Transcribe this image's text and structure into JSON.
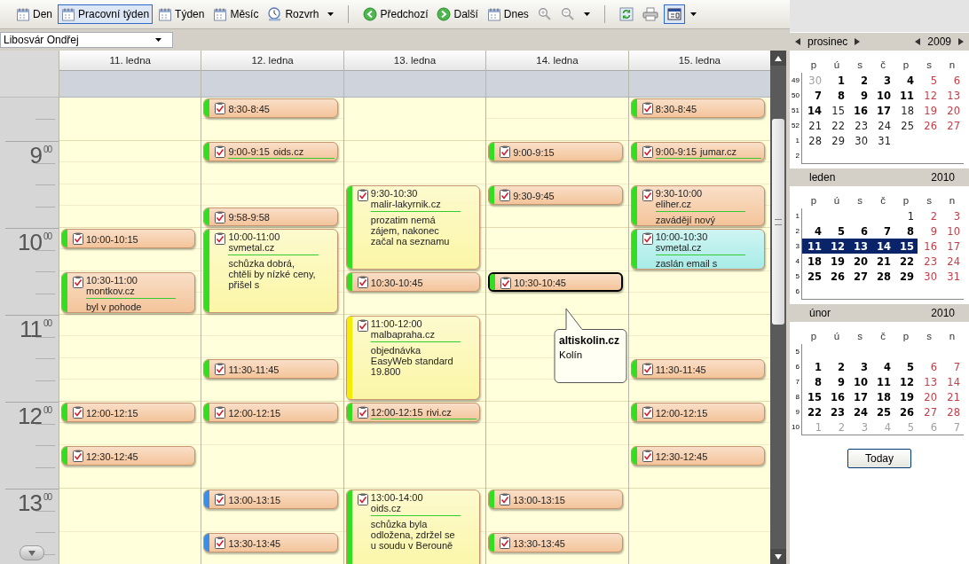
{
  "toolbar": {
    "views": [
      {
        "label": "Den",
        "selected": false
      },
      {
        "label": "Pracovní týden",
        "selected": true
      },
      {
        "label": "Týden",
        "selected": false
      },
      {
        "label": "Měsíc",
        "selected": false
      },
      {
        "label": "Rozvrh",
        "selected": false
      }
    ],
    "navigation": [
      {
        "label": "Předchozí"
      },
      {
        "label": "Další"
      },
      {
        "label": "Dnes"
      }
    ],
    "tools": [
      {
        "selected": false
      },
      {
        "selected": false
      },
      {
        "selected": true
      }
    ]
  },
  "user_select": {
    "value": "Libosvár Ondřej"
  },
  "hours": [
    {
      "label": "9$^{00}$"
    },
    {
      "label": "10$^{00}$"
    },
    {
      "label": "11$^{00}$"
    },
    {
      "label": "12$^{00}$"
    },
    {
      "label": "13$^{00}$"
    }
  ],
  "days": [
    {
      "label": "11. ledna",
      "events": [
        {
          "time": "10:00-10:15",
          "color": "#33dd22",
          "kind": "plain",
          "selected": false
        },
        {
          "time": "10:30-11:00",
          "subject": "montkov.cz",
          "notes": "byl v pohode",
          "color": "#33dd22",
          "kind": "plain",
          "selected": false
        },
        {
          "time": "12:00-12:15",
          "color": "#33dd22",
          "kind": "plain",
          "selected": false
        },
        {
          "time": "12:30-12:45",
          "color": "#33dd22",
          "kind": "plain",
          "selected": false
        }
      ]
    },
    {
      "label": "12. ledna",
      "events": [
        {
          "time": "8:30-8:45",
          "color": "#33dd22",
          "kind": "plain",
          "selected": false
        },
        {
          "time": "9:00-9:15",
          "subject": "oids.cz",
          "color": "#33dd22",
          "kind": "plain",
          "selected": false
        },
        {
          "time": "9:58-9:58",
          "color": "#33dd22",
          "kind": "plain",
          "selected": false
        },
        {
          "time": "10:00-11:00",
          "subject": "svmetal.cz",
          "notes": "schůzka dobrá, chtěli by nízké ceny, přišel s",
          "color": "#33dd22",
          "kind": "marked",
          "selected": false
        },
        {
          "time": "11:30-11:45",
          "color": "#33dd22",
          "kind": "plain",
          "selected": false
        },
        {
          "time": "12:00-12:15",
          "color": "#33dd22",
          "kind": "plain",
          "selected": false
        },
        {
          "time": "13:00-13:15",
          "color": "#3a8ee6",
          "kind": "plain",
          "selected": false
        },
        {
          "time": "13:30-13:45",
          "color": "#3a8ee6",
          "kind": "plain",
          "selected": false
        }
      ]
    },
    {
      "label": "13. ledna",
      "events": [
        {
          "time": "9:30-10:30",
          "subject": "malir-lakyrnik.cz",
          "notes": "prozatim nemá zájem, nakonec začal na seznamu",
          "color": "#33dd22",
          "kind": "marked",
          "selected": false
        },
        {
          "time": "10:30-10:45",
          "color": "#33dd22",
          "kind": "plain",
          "selected": false
        },
        {
          "time": "11:00-12:00",
          "subject": "malbapraha.cz",
          "notes": "objednávka EasyWeb standard 19.800",
          "color": "#f2ee00",
          "kind": "marked",
          "selected": false
        },
        {
          "time": "12:00-12:15",
          "subject": "rivi.cz",
          "color": "#33dd22",
          "kind": "plain",
          "selected": false
        },
        {
          "time": "13:00-14:00",
          "subject": "oids.cz",
          "notes": "schůzka byla odložena, zdržel se u soudu v Berouně",
          "color": "#33dd22",
          "kind": "marked",
          "selected": false
        }
      ]
    },
    {
      "label": "14. ledna",
      "events": [
        {
          "time": "9:00-9:15",
          "color": "#33dd22",
          "kind": "plain",
          "selected": false
        },
        {
          "time": "9:30-9:45",
          "color": "#33dd22",
          "kind": "plain",
          "selected": false
        },
        {
          "time": "10:30-10:45",
          "color": "#33dd22",
          "kind": "plain",
          "selected": true
        },
        {
          "time": "13:00-13:15",
          "color": "#33dd22",
          "kind": "plain",
          "selected": false
        },
        {
          "time": "13:30-13:45",
          "color": "#33dd22",
          "kind": "plain",
          "selected": false
        }
      ]
    },
    {
      "label": "15. ledna",
      "events": [
        {
          "time": "8:30-8:45",
          "color": "#33dd22",
          "kind": "plain",
          "selected": false
        },
        {
          "time": "9:00-9:15",
          "subject": "jumar.cz",
          "color": "#33dd22",
          "kind": "plain",
          "selected": false
        },
        {
          "time": "9:30-10:00",
          "subject": "eliher.cz",
          "notes": "zavádějí nový",
          "color": "#33dd22",
          "kind": "plain",
          "selected": false
        },
        {
          "time": "10:00-10:30",
          "subject": "svmetal.cz",
          "notes": "zaslán email s",
          "color": "#33dd22",
          "kind": "alert",
          "selected": false
        },
        {
          "time": "11:30-11:45",
          "color": "#33dd22",
          "kind": "plain",
          "selected": false
        },
        {
          "time": "12:00-12:15",
          "color": "#33dd22",
          "kind": "plain",
          "selected": false
        },
        {
          "time": "12:30-12:45",
          "color": "#33dd22",
          "kind": "plain",
          "selected": false
        }
      ]
    }
  ],
  "tooltip": {
    "title": "altiskolin.cz",
    "text": "Kolín"
  },
  "months": [
    {
      "month": "prosinec",
      "year": "2009",
      "has_navigation": true,
      "weekdays": [
        "p",
        "ú",
        "s",
        "č",
        "p",
        "s",
        "n"
      ],
      "weeks": [
        {
          "number": "49",
          "days": [
            {
              "text": "30",
              "kind": "other",
              "selected": false
            },
            {
              "text": "1",
              "kind": "busy",
              "selected": false
            },
            {
              "text": "2",
              "kind": "busy",
              "selected": false
            },
            {
              "text": "3",
              "kind": "busy",
              "selected": false
            },
            {
              "text": "4",
              "kind": "busy",
              "selected": false
            },
            {
              "text": "5",
              "kind": "weekend",
              "selected": false
            },
            {
              "text": "6",
              "kind": "weekend",
              "selected": false
            }
          ]
        },
        {
          "number": "50",
          "days": [
            {
              "text": "7",
              "kind": "busy",
              "selected": false
            },
            {
              "text": "8",
              "kind": "busy",
              "selected": false
            },
            {
              "text": "9",
              "kind": "busy",
              "selected": false
            },
            {
              "text": "10",
              "kind": "busy",
              "selected": false
            },
            {
              "text": "11",
              "kind": "busy",
              "selected": false
            },
            {
              "text": "12",
              "kind": "weekend",
              "selected": false
            },
            {
              "text": "13",
              "kind": "weekend",
              "selected": false
            }
          ]
        },
        {
          "number": "51",
          "days": [
            {
              "text": "14",
              "kind": "busy",
              "selected": false
            },
            {
              "text": "15",
              "kind": "plain",
              "selected": false
            },
            {
              "text": "16",
              "kind": "busy",
              "selected": false
            },
            {
              "text": "17",
              "kind": "busy",
              "selected": false
            },
            {
              "text": "18",
              "kind": "plain",
              "selected": false
            },
            {
              "text": "19",
              "kind": "weekend",
              "selected": false
            },
            {
              "text": "20",
              "kind": "weekend",
              "selected": false
            }
          ]
        },
        {
          "number": "52",
          "days": [
            {
              "text": "21",
              "kind": "plain",
              "selected": false
            },
            {
              "text": "22",
              "kind": "plain",
              "selected": false
            },
            {
              "text": "23",
              "kind": "plain",
              "selected": false
            },
            {
              "text": "24",
              "kind": "plain",
              "selected": false
            },
            {
              "text": "25",
              "kind": "plain",
              "selected": false
            },
            {
              "text": "26",
              "kind": "weekend",
              "selected": false
            },
            {
              "text": "27",
              "kind": "weekend",
              "selected": false
            }
          ]
        },
        {
          "number": "1",
          "days": [
            {
              "text": "28",
              "kind": "plain",
              "selected": false
            },
            {
              "text": "29",
              "kind": "plain",
              "selected": false
            },
            {
              "text": "30",
              "kind": "plain",
              "selected": false
            },
            {
              "text": "31",
              "kind": "plain",
              "selected": false
            }
          ]
        },
        {
          "number": "2"
        }
      ]
    },
    {
      "month": "leden",
      "year": "2010",
      "has_navigation": false,
      "weekdays": [
        "p",
        "ú",
        "s",
        "č",
        "p",
        "s",
        "n"
      ],
      "weeks": [
        {
          "number": "1",
          "days": [
            {
              "text": "1",
              "kind": "plain",
              "selected": false
            },
            {
              "text": "2",
              "kind": "weekend",
              "selected": false
            },
            {
              "text": "3",
              "kind": "weekend",
              "selected": false
            }
          ]
        },
        {
          "number": "2",
          "days": [
            {
              "text": "4",
              "kind": "busy",
              "selected": false
            },
            {
              "text": "5",
              "kind": "busy",
              "selected": false
            },
            {
              "text": "6",
              "kind": "busy",
              "selected": false
            },
            {
              "text": "7",
              "kind": "busy",
              "selected": false
            },
            {
              "text": "8",
              "kind": "busy",
              "selected": false
            },
            {
              "text": "9",
              "kind": "weekend",
              "selected": false
            },
            {
              "text": "10",
              "kind": "weekend",
              "selected": false
            }
          ]
        },
        {
          "number": "3",
          "days": [
            {
              "text": "11",
              "kind": "busy",
              "selected": true
            },
            {
              "text": "12",
              "kind": "busy",
              "selected": true
            },
            {
              "text": "13",
              "kind": "busy",
              "selected": true
            },
            {
              "text": "14",
              "kind": "busy",
              "selected": true
            },
            {
              "text": "15",
              "kind": "busy",
              "selected": true
            },
            {
              "text": "16",
              "kind": "weekend",
              "selected": false
            },
            {
              "text": "17",
              "kind": "weekend",
              "selected": false
            }
          ]
        },
        {
          "number": "4",
          "days": [
            {
              "text": "18",
              "kind": "busy",
              "selected": false
            },
            {
              "text": "19",
              "kind": "busy",
              "selected": false
            },
            {
              "text": "20",
              "kind": "busy",
              "selected": false
            },
            {
              "text": "21",
              "kind": "busy",
              "selected": false
            },
            {
              "text": "22",
              "kind": "busy",
              "selected": false
            },
            {
              "text": "23",
              "kind": "weekend",
              "selected": false
            },
            {
              "text": "24",
              "kind": "weekend",
              "selected": false
            }
          ]
        },
        {
          "number": "5",
          "days": [
            {
              "text": "25",
              "kind": "busy",
              "selected": false
            },
            {
              "text": "26",
              "kind": "busy",
              "selected": false
            },
            {
              "text": "27",
              "kind": "busy",
              "selected": false
            },
            {
              "text": "28",
              "kind": "busy",
              "selected": false
            },
            {
              "text": "29",
              "kind": "busy",
              "selected": false
            },
            {
              "text": "30",
              "kind": "weekend",
              "selected": false
            },
            {
              "text": "31",
              "kind": "weekend",
              "selected": false
            }
          ]
        },
        {
          "number": "6"
        }
      ]
    },
    {
      "month": "únor",
      "year": "2010",
      "has_navigation": false,
      "weekdays": [
        "p",
        "ú",
        "s",
        "č",
        "p",
        "s",
        "n"
      ],
      "weeks": [
        {
          "number": "5"
        },
        {
          "number": "6",
          "days": [
            {
              "text": "1",
              "kind": "busy",
              "selected": false
            },
            {
              "text": "2",
              "kind": "busy",
              "selected": false
            },
            {
              "text": "3",
              "kind": "busy",
              "selected": false
            },
            {
              "text": "4",
              "kind": "busy",
              "selected": false
            },
            {
              "text": "5",
              "kind": "busy",
              "selected": false
            },
            {
              "text": "6",
              "kind": "weekend",
              "selected": false
            },
            {
              "text": "7",
              "kind": "weekend",
              "selected": false
            }
          ]
        },
        {
          "number": "7",
          "days": [
            {
              "text": "8",
              "kind": "busy",
              "selected": false
            },
            {
              "text": "9",
              "kind": "busy",
              "selected": false
            },
            {
              "text": "10",
              "kind": "busy",
              "selected": false
            },
            {
              "text": "11",
              "kind": "busy",
              "selected": false
            },
            {
              "text": "12",
              "kind": "busy",
              "selected": false
            },
            {
              "text": "13",
              "kind": "weekend",
              "selected": false
            },
            {
              "text": "14",
              "kind": "weekend",
              "selected": false
            }
          ]
        },
        {
          "number": "8",
          "days": [
            {
              "text": "15",
              "kind": "busy",
              "selected": false
            },
            {
              "text": "16",
              "kind": "busy",
              "selected": false
            },
            {
              "text": "17",
              "kind": "busy",
              "selected": false
            },
            {
              "text": "18",
              "kind": "busy",
              "selected": false
            },
            {
              "text": "19",
              "kind": "busy",
              "selected": false
            },
            {
              "text": "20",
              "kind": "weekend",
              "selected": false
            },
            {
              "text": "21",
              "kind": "weekend",
              "selected": false
            }
          ]
        },
        {
          "number": "9",
          "days": [
            {
              "text": "22",
              "kind": "busy",
              "selected": false
            },
            {
              "text": "23",
              "kind": "busy",
              "selected": false
            },
            {
              "text": "24",
              "kind": "busy",
              "selected": false
            },
            {
              "text": "25",
              "kind": "busy",
              "selected": false
            },
            {
              "text": "26",
              "kind": "busy",
              "selected": false
            },
            {
              "text": "27",
              "kind": "weekend",
              "selected": false
            },
            {
              "text": "28",
              "kind": "weekend",
              "selected": false
            }
          ]
        },
        {
          "number": "10",
          "days": [
            {
              "text": "1",
              "kind": "other",
              "selected": false
            },
            {
              "text": "2",
              "kind": "other",
              "selected": false
            },
            {
              "text": "3",
              "kind": "other",
              "selected": false
            },
            {
              "text": "4",
              "kind": "other",
              "selected": false
            },
            {
              "text": "5",
              "kind": "other",
              "selected": false
            },
            {
              "text": "6",
              "kind": "other",
              "selected": false
            },
            {
              "text": "7",
              "kind": "other",
              "selected": false
            }
          ]
        }
      ]
    }
  ],
  "today_button": "Today"
}
